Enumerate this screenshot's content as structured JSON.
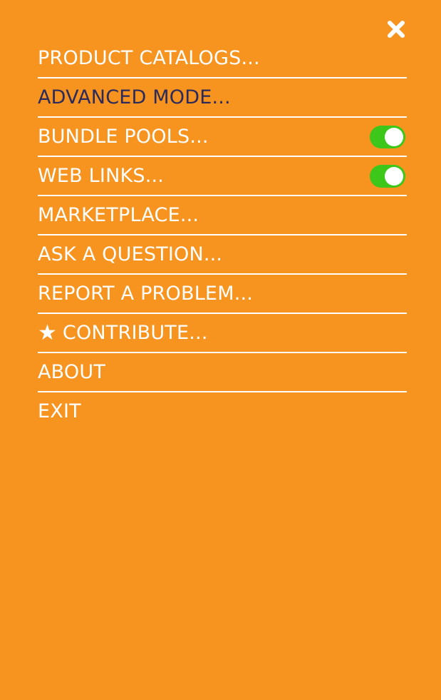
{
  "close": {
    "icon": "close-icon"
  },
  "menu": {
    "items": [
      {
        "label": "PRODUCT CATALOGS..."
      },
      {
        "label": "ADVANCED MODE...",
        "active": true
      },
      {
        "label": "BUNDLE POOLS...",
        "toggle": true,
        "toggle_on": true
      },
      {
        "label": "WEB LINKS...",
        "toggle": true,
        "toggle_on": true
      },
      {
        "label": "MARKETPLACE..."
      },
      {
        "label": "ASK A QUESTION..."
      },
      {
        "label": "REPORT A PROBLEM..."
      },
      {
        "label": "CONTRIBUTE...",
        "icon": "star-icon",
        "icon_glyph": "★"
      },
      {
        "label": "ABOUT"
      },
      {
        "label": "EXIT"
      }
    ]
  },
  "colors": {
    "background": "#F7941F",
    "text": "#FFFFFF",
    "active_text": "#2B2A5A",
    "toggle_on": "#3EC71B"
  }
}
